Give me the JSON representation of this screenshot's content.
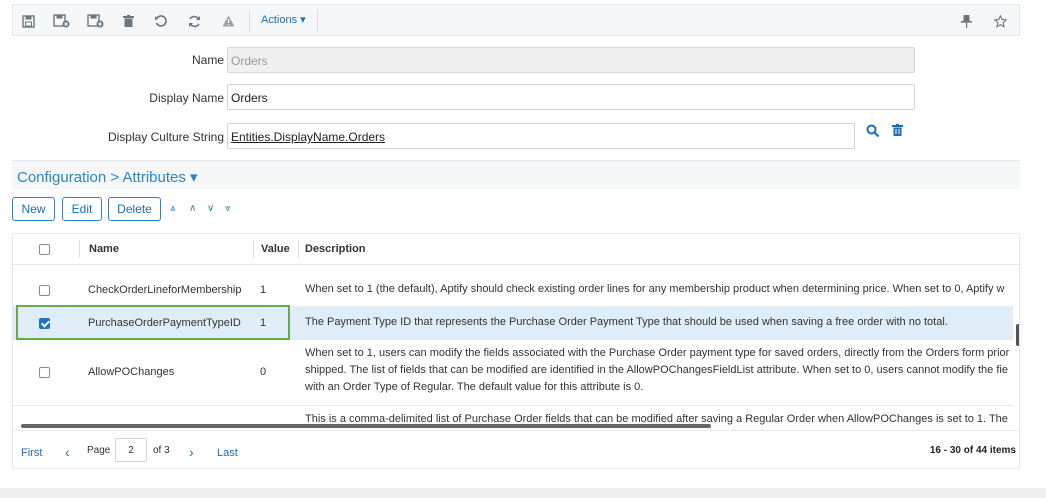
{
  "toolbar": {
    "icons": [
      "save-icon",
      "save-and-close-icon",
      "save-and-new-icon",
      "delete-icon",
      "undo-icon",
      "refresh-icon",
      "warning-icon"
    ],
    "actions_label": "Actions ▾",
    "right_icons": [
      "pin-icon",
      "star-icon"
    ]
  },
  "form": {
    "name_label": "Name",
    "name_value": "Orders",
    "display_name_label": "Display Name",
    "display_name_value": "Orders",
    "culture_label": "Display Culture String",
    "culture_value": "Entities.DisplayName.Orders"
  },
  "config": {
    "title": "Configuration > Attributes ▾",
    "buttons": {
      "new": "New",
      "edit": "Edit",
      "delete": "Delete"
    },
    "arrows": [
      "⩓",
      "∧",
      "∨",
      "⩔"
    ]
  },
  "grid": {
    "headers": {
      "name": "Name",
      "value": "Value",
      "description": "Description"
    },
    "rows": [
      {
        "name": "CheckOrderLineforMembership",
        "value": "1",
        "desc": [
          "When set to 1 (the default), Aptify should check existing order lines for any membership product when determining price. When set to 0, Aptify w"
        ],
        "checked": false
      },
      {
        "name": "PurchaseOrderPaymentTypeID",
        "value": "1",
        "desc": [
          "The Payment Type ID that represents the Purchase Order Payment Type that should be used when saving a free order with no total."
        ],
        "checked": true
      },
      {
        "name": "AllowPOChanges",
        "value": "0",
        "desc": [
          "When set to 1, users can modify the fields associated with the Purchase Order payment type for saved orders, directly from the Orders form prior",
          "shipped. The list of fields that can be modified are identified in the AllowPOChangesFieldList attribute. When set to 0, users cannot modify the fie",
          "with an Order Type of Regular. The default value for this attribute is 0."
        ],
        "checked": false
      },
      {
        "name": "",
        "value": "",
        "desc": [
          "This is a comma-delimited list of Purchase Order fields that can be modified after saving a Regular Order when AllowPOChanges is set to 1. The"
        ],
        "checked": false
      }
    ]
  },
  "pager": {
    "first": "First",
    "prev": "‹",
    "page_label": "Page",
    "page_value": "2",
    "of_label": "of 3",
    "next": "›",
    "last": "Last",
    "count": "16 - 30 of 44 items"
  }
}
